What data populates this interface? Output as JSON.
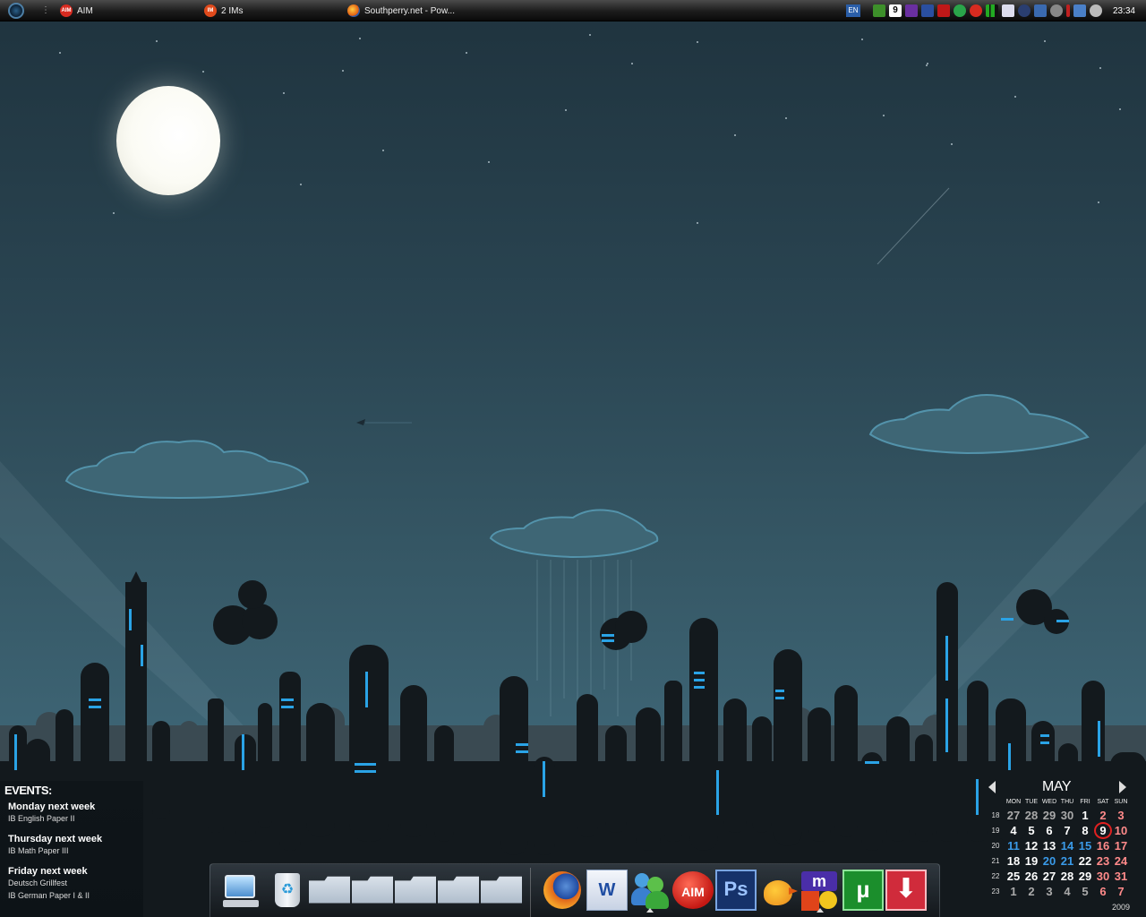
{
  "taskbar": {
    "tasks": [
      {
        "label": "AIM",
        "icon": "aim-icon"
      },
      {
        "label": "2 IMs",
        "icon": "im-icon"
      },
      {
        "label": "Southperry.net - Pow...",
        "icon": "firefox-icon"
      }
    ],
    "tray": {
      "language": "EN",
      "clock": "23:34"
    }
  },
  "events": {
    "title": "EVENTS:",
    "items": [
      {
        "when": "Monday next week",
        "what": "IB English Paper II"
      },
      {
        "when": "Thursday next week",
        "what": "IB Math Paper III"
      },
      {
        "when": "Friday next week",
        "what": [
          "Deutsch Grillfest",
          "IB German Paper I & II"
        ]
      }
    ]
  },
  "dock": {
    "items": [
      "computer-icon",
      "recycle-bin-icon",
      "folder-icon",
      "pictures-folder-icon",
      "documents-folder-icon",
      "folder-icon",
      "folder-icon",
      "firefox-icon",
      "word-icon",
      "messenger-icon",
      "aim-icon",
      "photoshop-icon",
      "twitter-bird-icon",
      "mirc-icon",
      "utorrent-icon",
      "download-icon"
    ],
    "labels": {
      "aim": "AIM",
      "photoshop": "Ps",
      "utorrent": "µ",
      "word": "W"
    }
  },
  "calendar": {
    "month": "MAY",
    "year": "2009",
    "weekdays": [
      "MON",
      "TUE",
      "WED",
      "THU",
      "FRI",
      "SAT",
      "SUN"
    ],
    "weeks": [
      {
        "wk": "18",
        "days": [
          "27",
          "28",
          "29",
          "30",
          "1",
          "2",
          "3"
        ]
      },
      {
        "wk": "19",
        "days": [
          "4",
          "5",
          "6",
          "7",
          "8",
          "9",
          "10"
        ]
      },
      {
        "wk": "20",
        "days": [
          "11",
          "12",
          "13",
          "14",
          "15",
          "16",
          "17"
        ]
      },
      {
        "wk": "21",
        "days": [
          "18",
          "19",
          "20",
          "21",
          "22",
          "23",
          "24"
        ]
      },
      {
        "wk": "22",
        "days": [
          "25",
          "26",
          "27",
          "28",
          "29",
          "30",
          "31"
        ]
      },
      {
        "wk": "23",
        "days": [
          "1",
          "2",
          "3",
          "4",
          "5",
          "6",
          "7"
        ]
      }
    ],
    "today": "9"
  }
}
